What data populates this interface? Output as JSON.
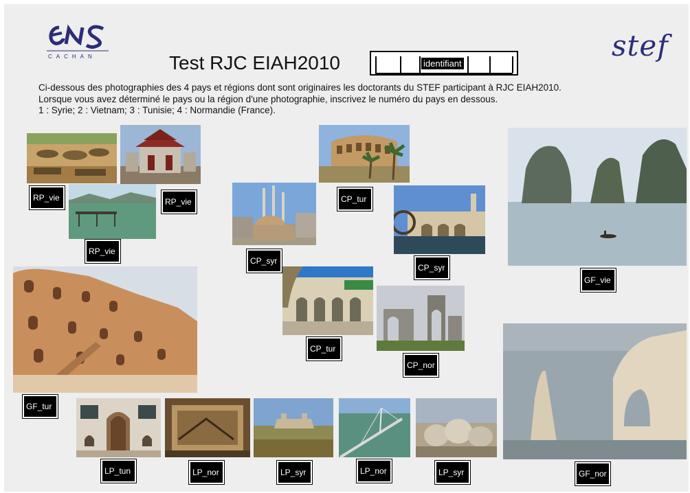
{
  "header": {
    "title": "Test RJC EIAH2010",
    "id_label": "identifiant",
    "ens_logo_text": "ENS",
    "ens_logo_subtext": "CACHAN",
    "stef_logo_text": "stef"
  },
  "intro": {
    "line1": "Ci-dessous des photographies des 4 pays et régions dont sont originaires les doctorants du STEF participant à RJC EIAH2010.",
    "line2": "Lorsque vous avez déterminé le pays ou la région d'une photographie, inscrivez le numéro du pays en dessous.",
    "line3": "1 : Syrie;  2 : Vietnam;  3 : Tunisie;  4 : Normandie (France)."
  },
  "labels": {
    "rp_vie_1": "RP_vie",
    "rp_vie_2": "RP_vie",
    "rp_vie_3": "RP_vie",
    "cp_tur_1": "CP_tur",
    "cp_syr_1": "CP_syr",
    "cp_syr_2": "CP_syr",
    "cp_tur_2": "CP_tur",
    "cp_nor": "CP_nor",
    "gf_vie": "GF_vie",
    "gf_tur": "GF_tur",
    "gf_nor": "GF_nor",
    "lp_tun": "LP_tun",
    "lp_nor_1": "LP_nor",
    "lp_syr_1": "LP_syr",
    "lp_nor_2": "LP_nor",
    "lp_syr_2": "LP_syr"
  },
  "colors": {
    "ens_blue": "#2b2c7a",
    "label_bg": "#000000",
    "label_text": "#ffffff",
    "sheet_bg": "#eeeeee"
  }
}
